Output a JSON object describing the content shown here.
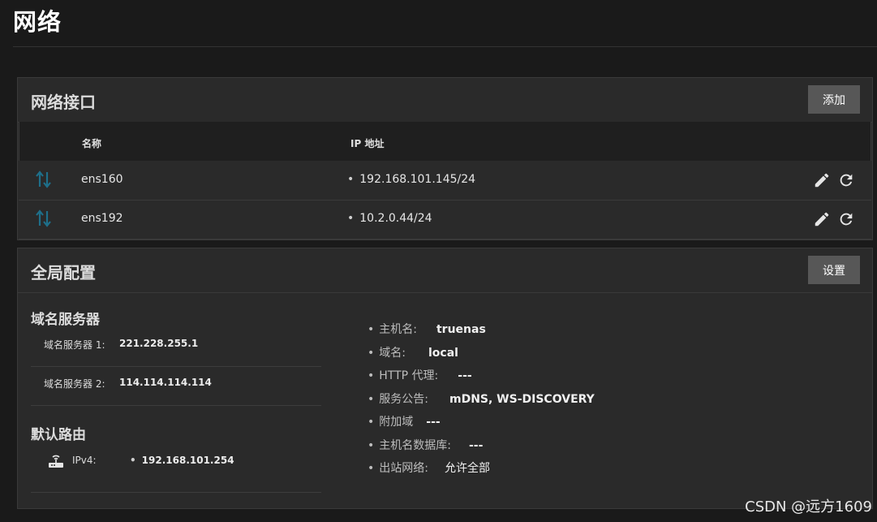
{
  "page": {
    "title": "网络"
  },
  "interfaces_card": {
    "title": "网络接口",
    "add_button": "添加",
    "columns": [
      "名称",
      "IP 地址"
    ],
    "rows": [
      {
        "name": "ens160",
        "ip": "192.168.101.145/24",
        "icon": "up-down-arrows-icon"
      },
      {
        "name": "ens192",
        "ip": "10.2.0.44/24",
        "icon": "up-down-arrows-icon"
      }
    ]
  },
  "global_card": {
    "title": "全局配置",
    "settings_button": "设置",
    "dns": {
      "title": "域名服务器",
      "servers": [
        {
          "label": "域名服务器 1:",
          "value": "221.228.255.1"
        },
        {
          "label": "域名服务器 2:",
          "value": "114.114.114.114"
        }
      ]
    },
    "default_route": {
      "title": "默认路由",
      "label": "IPv4:",
      "value": "192.168.101.254",
      "icon": "router-icon"
    },
    "info": [
      {
        "label": "主机名:",
        "value": "truenas"
      },
      {
        "label": "域名:",
        "value": "local"
      },
      {
        "label": "HTTP 代理:",
        "value": "---"
      },
      {
        "label": "服务公告:",
        "value": "mDNS, WS-DISCOVERY"
      },
      {
        "label": "附加域",
        "value": "---"
      },
      {
        "label": "主机名数据库:",
        "value": "---"
      },
      {
        "label": "出站网络:",
        "value": "允许全部"
      }
    ]
  },
  "watermark": "CSDN @远方1609",
  "colors": {
    "background": "#1a1a1a",
    "card": "#2a2a2a",
    "button": "#575757",
    "iface_icon": "#1e6f8a"
  }
}
